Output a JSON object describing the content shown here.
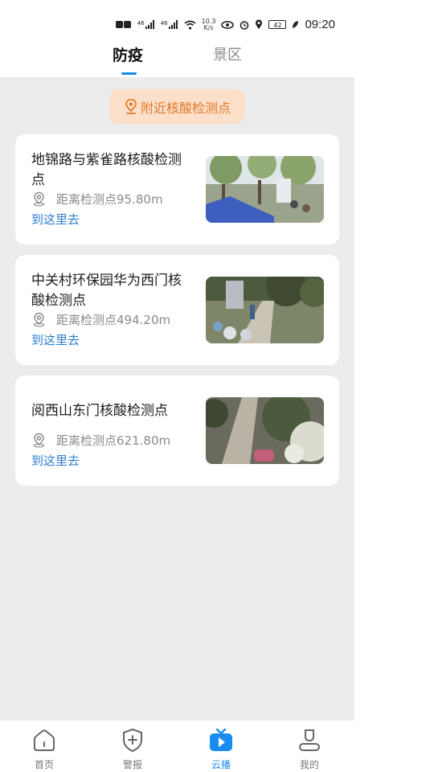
{
  "status_bar": {
    "network_speed_value": "10.3",
    "network_speed_unit": "K/s",
    "signal_1": "46",
    "signal_2": "46",
    "battery": "42",
    "time": "09:20"
  },
  "tabs": [
    {
      "label": "防疫",
      "active": true
    },
    {
      "label": "景区",
      "active": false
    }
  ],
  "nearby_button": {
    "label": "附近核酸检测点",
    "icon": "location-pin-icon"
  },
  "sites": [
    {
      "name": "地锦路与紫雀路核酸检测点",
      "distance": "距离检测点95.80m",
      "go": "到这里去"
    },
    {
      "name": "中关村环保园华为西门核酸检测点",
      "distance": "距离检测点494.20m",
      "go": "到这里去"
    },
    {
      "name": "阅西山东门核酸检测点",
      "distance": "距离检测点621.80m",
      "go": "到这里去"
    }
  ],
  "bottom_nav": [
    {
      "label": "首页",
      "icon": "home-icon",
      "active": false
    },
    {
      "label": "警报",
      "icon": "shield-plus-icon",
      "active": false
    },
    {
      "label": "云播",
      "icon": "tv-play-icon",
      "active": true
    },
    {
      "label": "我的",
      "icon": "person-icon",
      "active": false
    }
  ],
  "colors": {
    "accent": "#1a8cf0",
    "orange": "#e37a2a",
    "link": "#2d7fd0",
    "background": "#ececec"
  }
}
